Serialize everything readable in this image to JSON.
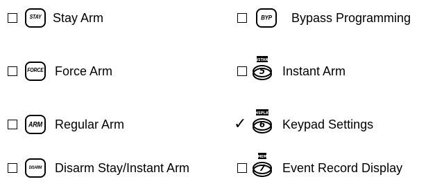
{
  "left_items": [
    {
      "key": "STAY",
      "label": "Stay Arm",
      "checked": false
    },
    {
      "key": "FORCE",
      "label": "Force Arm",
      "checked": false
    },
    {
      "key": "ARM",
      "label": "Regular Arm",
      "checked": false
    },
    {
      "key": "DISARM",
      "label": "Disarm Stay/Instant Arm",
      "checked": false
    }
  ],
  "right_items": [
    {
      "key": "BYP",
      "label": "Bypass Programming",
      "checked": false
    },
    {
      "key_caption": "INSTANT",
      "key_number": "5",
      "label": "Instant Arm",
      "checked": false
    },
    {
      "key_caption": "DISPLAY",
      "key_number": "6",
      "label": "Keypad Settings",
      "checked": true,
      "mark": "✓"
    },
    {
      "key_caption": "MEM",
      "key_number": "7",
      "label": "Event Record Display",
      "checked": false
    }
  ]
}
